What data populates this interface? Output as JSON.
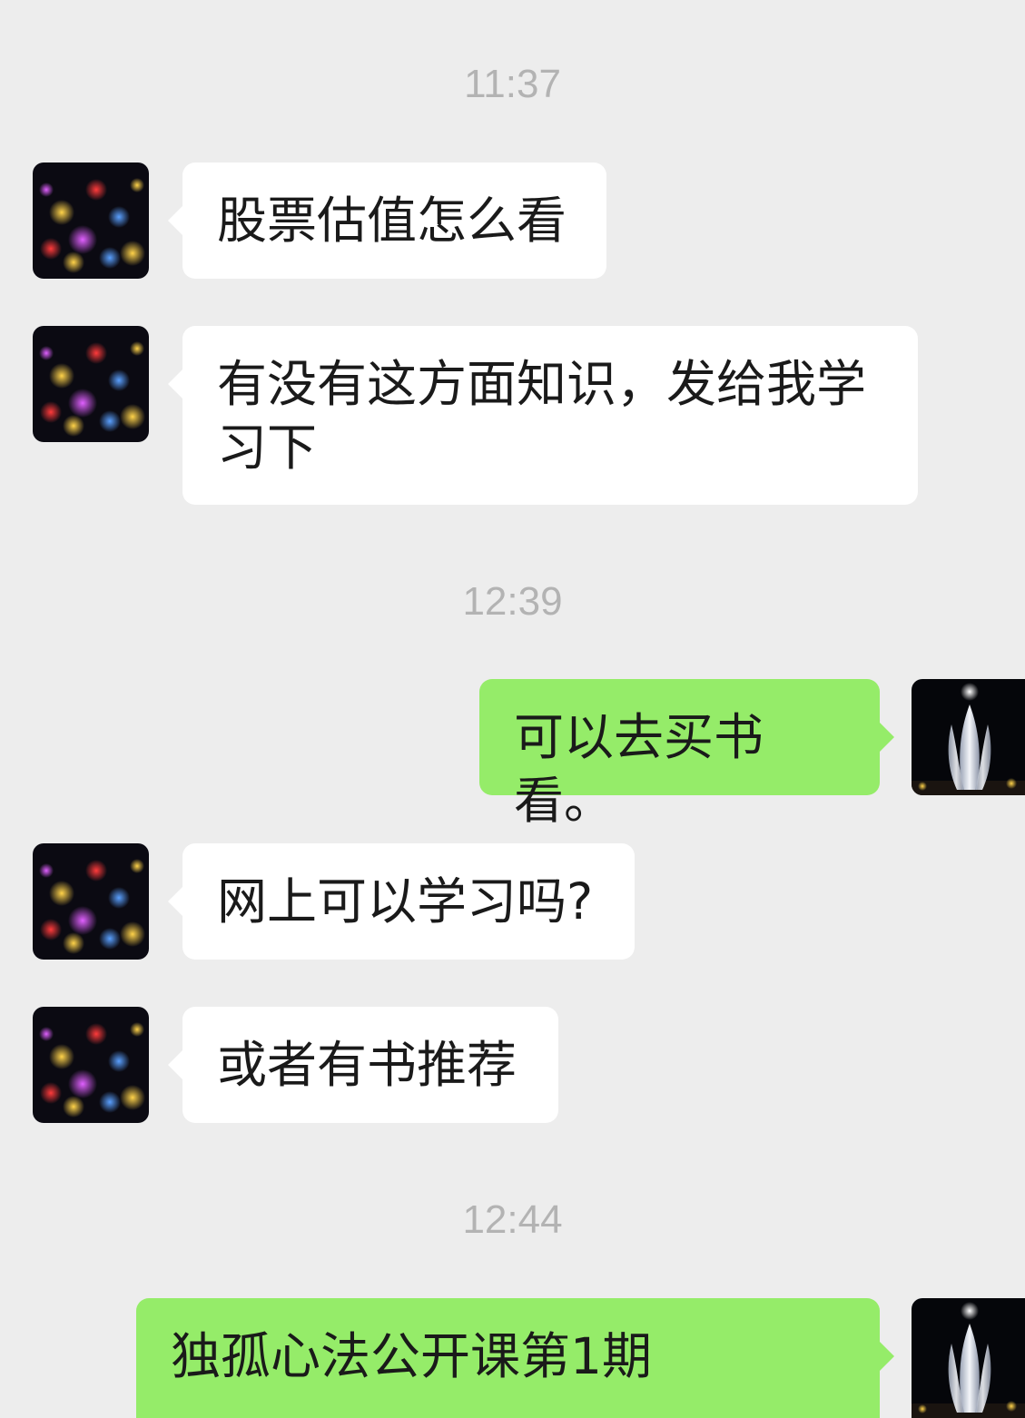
{
  "chat": {
    "timestamps": [
      "11:37",
      "12:39",
      "12:44"
    ],
    "messages": [
      {
        "side": "incoming",
        "text": "股票估值怎么看"
      },
      {
        "side": "incoming",
        "text": "有没有这方面知识，发给我学习下"
      },
      {
        "side": "outgoing",
        "text": "可以去买书看。"
      },
      {
        "side": "incoming",
        "text": "网上可以学习吗?"
      },
      {
        "side": "incoming",
        "text": "或者有书推荐"
      },
      {
        "side": "outgoing",
        "text": "独孤心法公开课第1期"
      }
    ]
  },
  "avatars": {
    "incoming": "night-lights-avatar",
    "outgoing": "lotus-sculpture-avatar"
  },
  "colors": {
    "background": "#ededed",
    "incoming_bubble": "#ffffff",
    "outgoing_bubble": "#95ec69",
    "timestamp_text": "#b3b3b3",
    "message_text": "#1a1a1a"
  }
}
